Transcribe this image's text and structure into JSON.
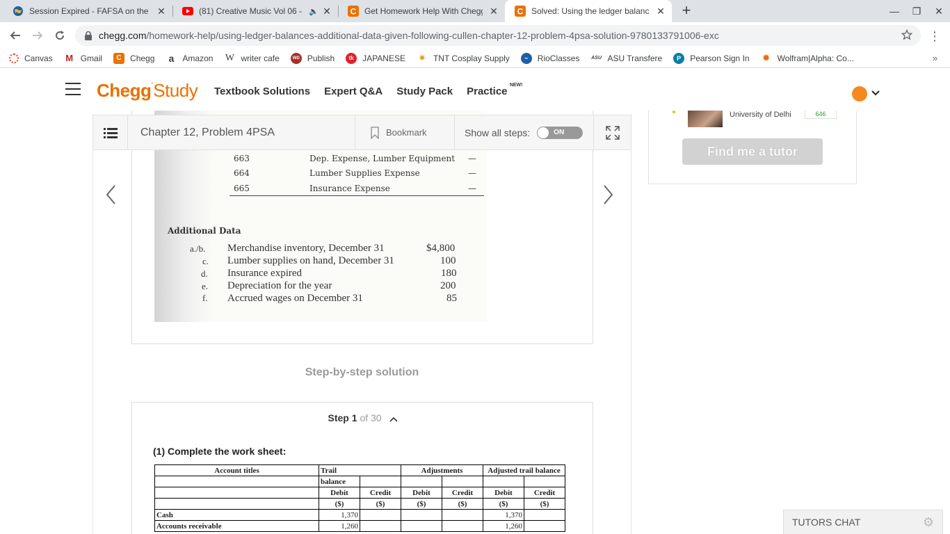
{
  "tabs": [
    {
      "title": "Session Expired - FAFSA on the Web",
      "icon": "globe-icon"
    },
    {
      "title": "(81) Creative Music Vol 06 - ",
      "icon": "youtube-icon"
    },
    {
      "title": "Get Homework Help With Chegg",
      "icon": "chegg-icon"
    },
    {
      "title": "Solved: Using the ledger balances",
      "icon": "chegg-icon",
      "active": true
    }
  ],
  "address": {
    "domain": "chegg.com",
    "path": "/homework-help/using-ledger-balances-additional-data-given-following-cullen-chapter-12-problem-4psa-solution-9780133791006-exc"
  },
  "bookmarks": [
    {
      "label": "Canvas",
      "color": "#e24a2d"
    },
    {
      "label": "Gmail",
      "color": "#c5221f"
    },
    {
      "label": "Chegg",
      "color": "#eb7100"
    },
    {
      "label": "Amazon",
      "color": "#222222"
    },
    {
      "label": "writer cafe",
      "color": "#222222"
    },
    {
      "label": "Publish",
      "color": "#a8302a"
    },
    {
      "label": "JAPANESE",
      "color": "#e5202a"
    },
    {
      "label": "TNT Cosplay Supply",
      "color": "#d4a020"
    },
    {
      "label": "RioClasses",
      "color": "#1b5fa8"
    },
    {
      "label": "ASU Transfere",
      "color": "#222222"
    },
    {
      "label": "Pearson Sign In",
      "color": "#0a7ea8"
    },
    {
      "label": "Wolfram|Alpha: Co...",
      "color": "#e86a10"
    }
  ],
  "header": {
    "logo_brand": "Chegg",
    "logo_product": "Study",
    "nav": [
      "Textbook Solutions",
      "Expert Q&A",
      "Study Pack",
      "Practice"
    ],
    "practice_badge": "NEW!"
  },
  "sticky": {
    "chapter": "Chapter 12, Problem 4PSA",
    "bookmark": "Bookmark",
    "show_steps": "Show all steps:",
    "toggle": "ON"
  },
  "ledger": [
    {
      "no": "663",
      "name": "Dep. Expense, Lumber Equipment",
      "bal": "—"
    },
    {
      "no": "664",
      "name": "Lumber Supplies Expense",
      "bal": "—"
    },
    {
      "no": "665",
      "name": "Insurance Expense",
      "bal": "—"
    }
  ],
  "additional_data": {
    "title": "Additional Data",
    "items": [
      {
        "key": "a./b.",
        "text": "Merchandise inventory, December 31",
        "value": "$4,800"
      },
      {
        "key": "c.",
        "text": "Lumber supplies on hand, December 31",
        "value": "100"
      },
      {
        "key": "d.",
        "text": "Insurance expired",
        "value": "180"
      },
      {
        "key": "e.",
        "text": "Depreciation for the year",
        "value": "200"
      },
      {
        "key": "f.",
        "text": "Accrued wages on December 31",
        "value": "85"
      }
    ]
  },
  "solution": {
    "title": "Step-by-step solution",
    "step_label": "Step",
    "step_num": "1",
    "step_of": "of 30",
    "worksheet_label": "(1) Complete the work sheet:",
    "table": {
      "h_account": "Account titles",
      "h_trial": "Trail",
      "h_trial2": "balance",
      "h_adj": "Adjustments",
      "h_adjtb": "Adjusted trail balance",
      "h_debit": "Debit",
      "h_credit": "Credit",
      "h_dollar": "($)",
      "rows": [
        {
          "title": "Cash",
          "tb_debit": "1,370",
          "atb_debit": "1,370"
        },
        {
          "title": "Accounts receivable",
          "tb_debit": "1,260",
          "atb_debit": "1,260"
        }
      ]
    }
  },
  "tutor": {
    "university": "University of Delhi",
    "badge": "646",
    "cta": "Find me a tutor"
  },
  "chat": {
    "label": "TUTORS CHAT"
  }
}
